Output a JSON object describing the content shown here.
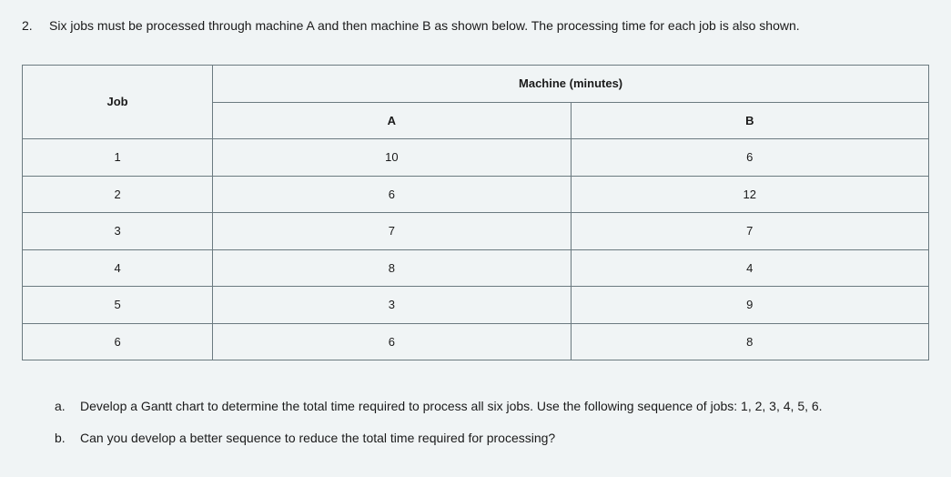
{
  "question": {
    "number": "2.",
    "text": "Six jobs must be processed through machine A and then machine B as shown below. The processing time for each job is also shown."
  },
  "table": {
    "header_job": "Job",
    "header_machine": "Machine (minutes)",
    "subheader_a": "A",
    "subheader_b": "B",
    "rows": [
      {
        "job": "1",
        "a": "10",
        "b": "6"
      },
      {
        "job": "2",
        "a": "6",
        "b": "12"
      },
      {
        "job": "3",
        "a": "7",
        "b": "7"
      },
      {
        "job": "4",
        "a": "8",
        "b": "4"
      },
      {
        "job": "5",
        "a": "3",
        "b": "9"
      },
      {
        "job": "6",
        "a": "6",
        "b": "8"
      }
    ]
  },
  "subquestions": {
    "a_letter": "a.",
    "a_text": "Develop a Gantt chart to determine the total time required to process all six jobs. Use the following sequence of jobs: 1, 2, 3, 4, 5, 6.",
    "b_letter": "b.",
    "b_text": "Can you develop a better sequence to reduce the total time required for processing?"
  },
  "chart_data": {
    "type": "table",
    "title": "Processing time by job and machine (minutes)",
    "columns": [
      "Job",
      "Machine A",
      "Machine B"
    ],
    "rows": [
      [
        1,
        10,
        6
      ],
      [
        2,
        6,
        12
      ],
      [
        3,
        7,
        7
      ],
      [
        4,
        8,
        4
      ],
      [
        5,
        3,
        9
      ],
      [
        6,
        6,
        8
      ]
    ]
  }
}
